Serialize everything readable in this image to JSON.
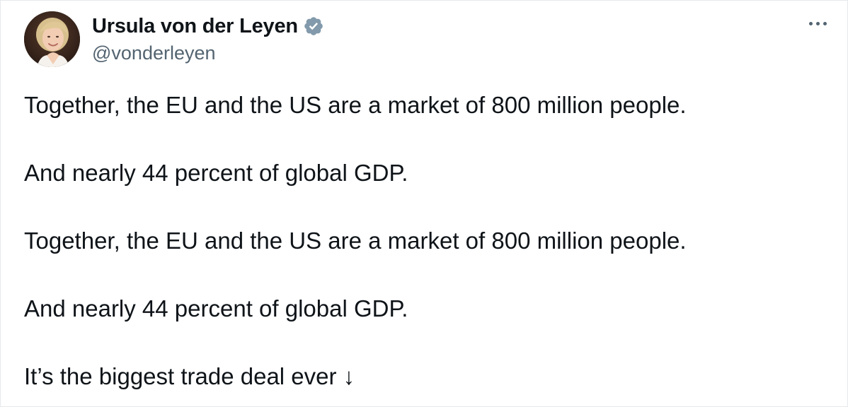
{
  "tweet": {
    "author": {
      "display_name": "Ursula von der Leyen",
      "handle": "@vonderleyen",
      "verified": true,
      "avatar_icon": "profile-photo",
      "verified_icon": "verified-badge-icon"
    },
    "more_icon": "more-horizontal-icon",
    "paragraphs": [
      "Together, the EU and the US are a market of 800 million people.",
      "And nearly 44 percent of global GDP.",
      "Together, the EU and the US are a market of 800 million people.",
      "And nearly 44 percent of global GDP.",
      "It’s the biggest trade deal ever ↓"
    ]
  },
  "colors": {
    "text_primary": "#0f1419",
    "text_secondary": "#536471",
    "verified_badge": "#829aab",
    "border": "#e6e8ea"
  }
}
